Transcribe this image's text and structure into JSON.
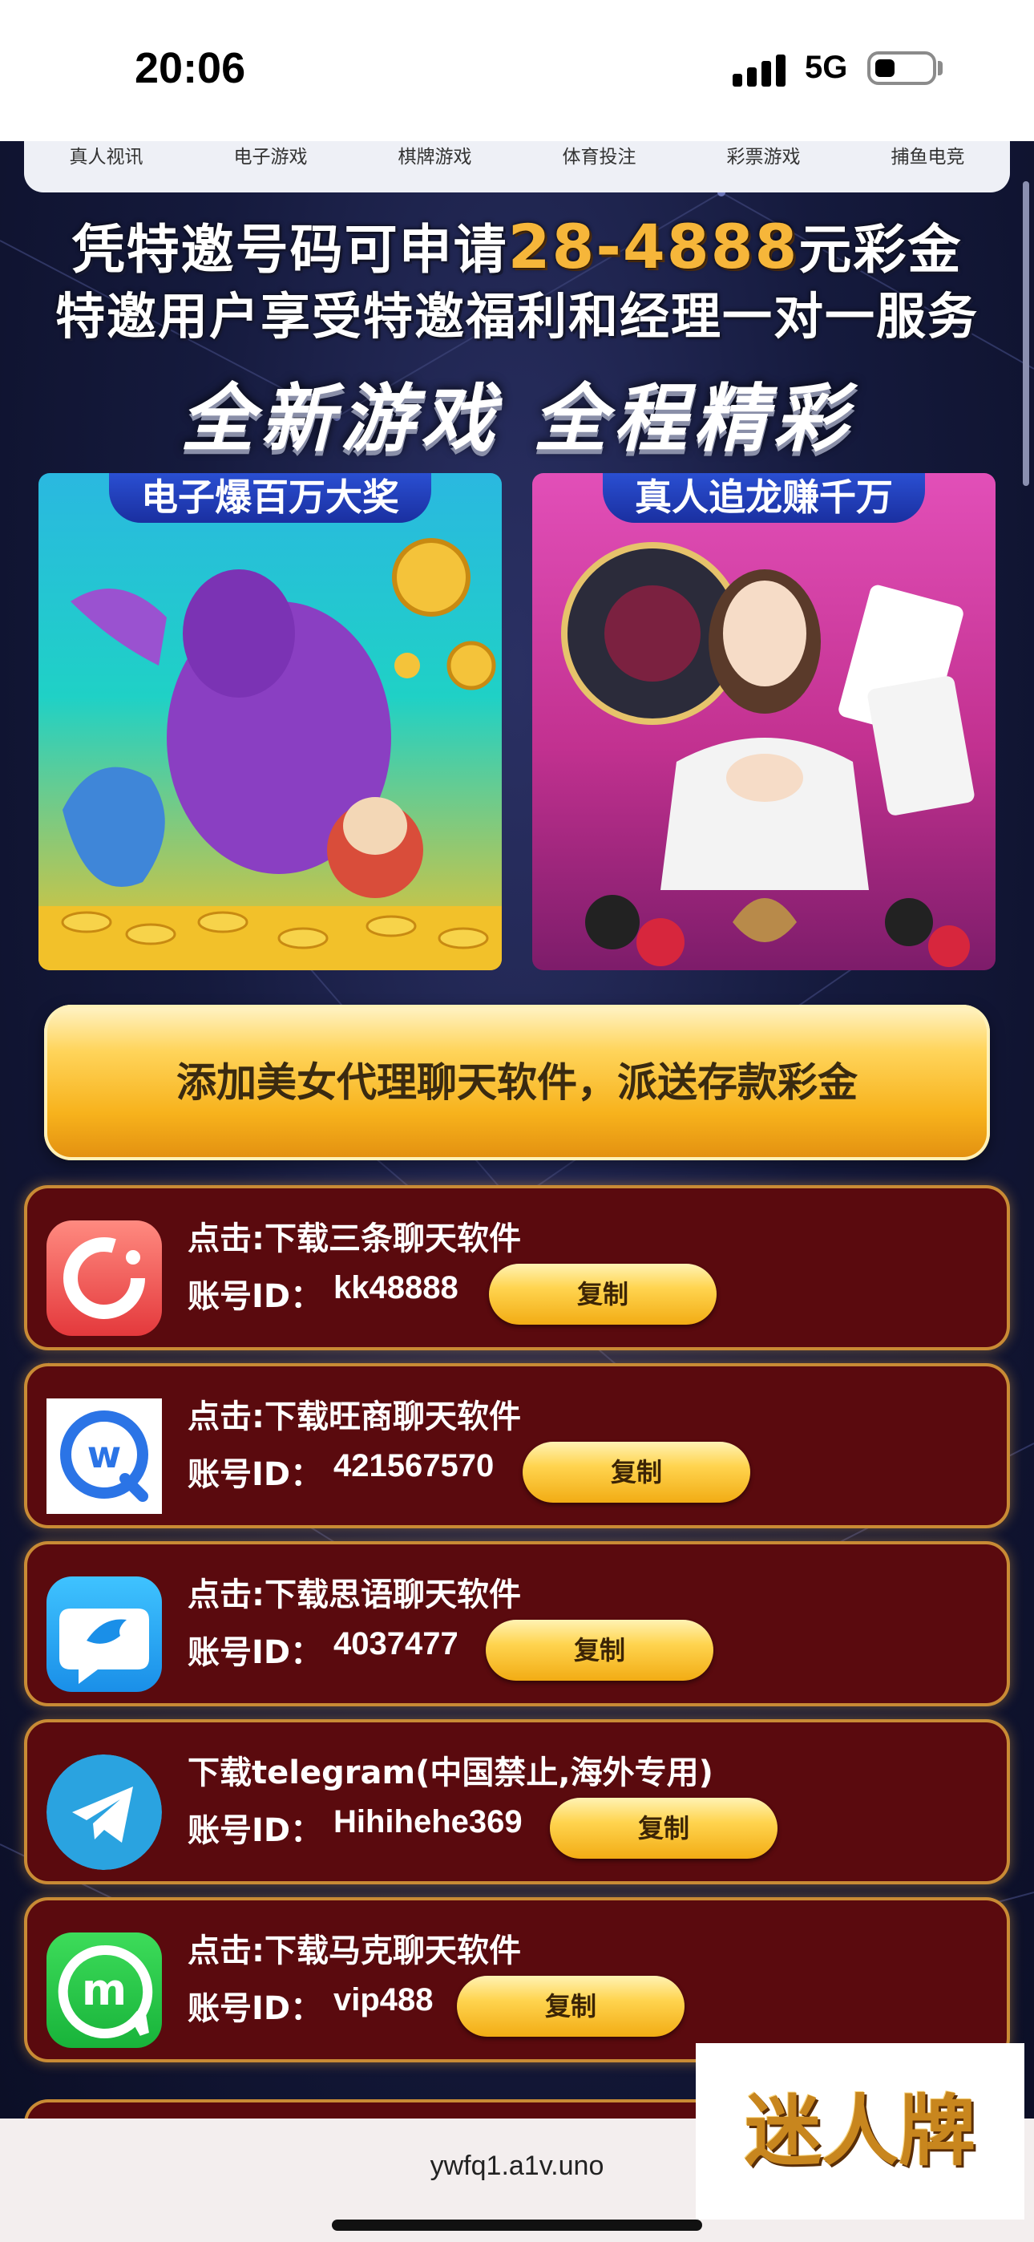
{
  "status_bar": {
    "time": "20:06",
    "network": "5G"
  },
  "nav": {
    "items": [
      "真人视讯",
      "电子游戏",
      "棋牌游戏",
      "体育投注",
      "彩票游戏",
      "捕鱼电竞"
    ]
  },
  "promo": {
    "line1_prefix": "凭特邀号码可申请",
    "line1_amount": "28-4888",
    "line1_suffix": "元彩金",
    "line2": "特邀用户享受特邀福利和经理一对一服务",
    "line3": "全新游戏 全程精彩"
  },
  "cards": {
    "left_tag": "电子爆百万大奖",
    "right_tag": "真人追龙赚千万"
  },
  "gold_banner": "添加美女代理聊天软件，派送存款彩金",
  "contacts": [
    {
      "title": "点击:下载三条聊天软件",
      "id_label": "账号ID：",
      "id_value": "kk48888",
      "copy": "复制",
      "icon": "three-chat-icon"
    },
    {
      "title": "点击:下载旺商聊天软件",
      "id_label": "账号ID：",
      "id_value": "421567570",
      "copy": "复制",
      "icon": "wangshang-icon"
    },
    {
      "title": "点击:下载思语聊天软件",
      "id_label": "账号ID：",
      "id_value": "4037477",
      "copy": "复制",
      "icon": "siyu-bird-icon"
    },
    {
      "title": "下载telegram(中国禁止,海外专用)",
      "id_label": "账号ID：",
      "id_value": "Hihihehe369",
      "copy": "复制",
      "icon": "telegram-icon"
    },
    {
      "title": "点击:下载马克聊天软件",
      "id_label": "账号ID：",
      "id_value": "vip488",
      "copy": "复制",
      "icon": "make-chat-icon"
    }
  ],
  "browser": {
    "url": "ywfq1.a1v.uno"
  },
  "watermark": "迷人牌",
  "colors": {
    "gold": "#f6b63a",
    "row_bg": "#5a0a0e",
    "row_border": "#c98b35"
  }
}
